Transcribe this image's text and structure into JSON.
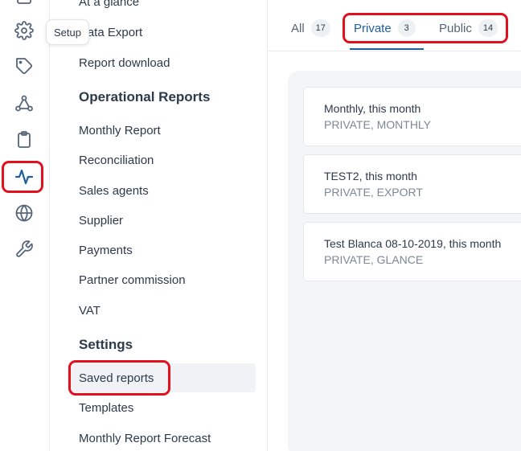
{
  "rail": {
    "items": [
      "gear-icon",
      "tag-icon",
      "network-icon",
      "clipboard-icon",
      "activity-icon",
      "globe-icon",
      "wrench-icon"
    ],
    "tooltip": "Setup"
  },
  "subnav": {
    "top_links": [
      "At a glance",
      "Data Export",
      "Report download"
    ],
    "operational_heading": "Operational Reports",
    "operational_links": [
      "Monthly Report",
      "Reconciliation",
      "Sales agents",
      "Supplier",
      "Payments",
      "Partner commission",
      "VAT"
    ],
    "settings_heading": "Settings",
    "settings_links": [
      "Saved reports",
      "Templates",
      "Monthly Report Forecast"
    ]
  },
  "tabs": [
    {
      "label": "All",
      "count": "17"
    },
    {
      "label": "Private",
      "count": "3"
    },
    {
      "label": "Public",
      "count": "14"
    }
  ],
  "reports": [
    {
      "title": "Monthly, this month",
      "meta": "PRIVATE, MONTHLY"
    },
    {
      "title": "TEST2, this month",
      "meta": "PRIVATE, EXPORT"
    },
    {
      "title": "Test Blanca 08-10-2019, this month",
      "meta": "PRIVATE, GLANCE"
    }
  ],
  "colors": {
    "accent": "#1f5f9e",
    "annotation": "#e0101c"
  }
}
